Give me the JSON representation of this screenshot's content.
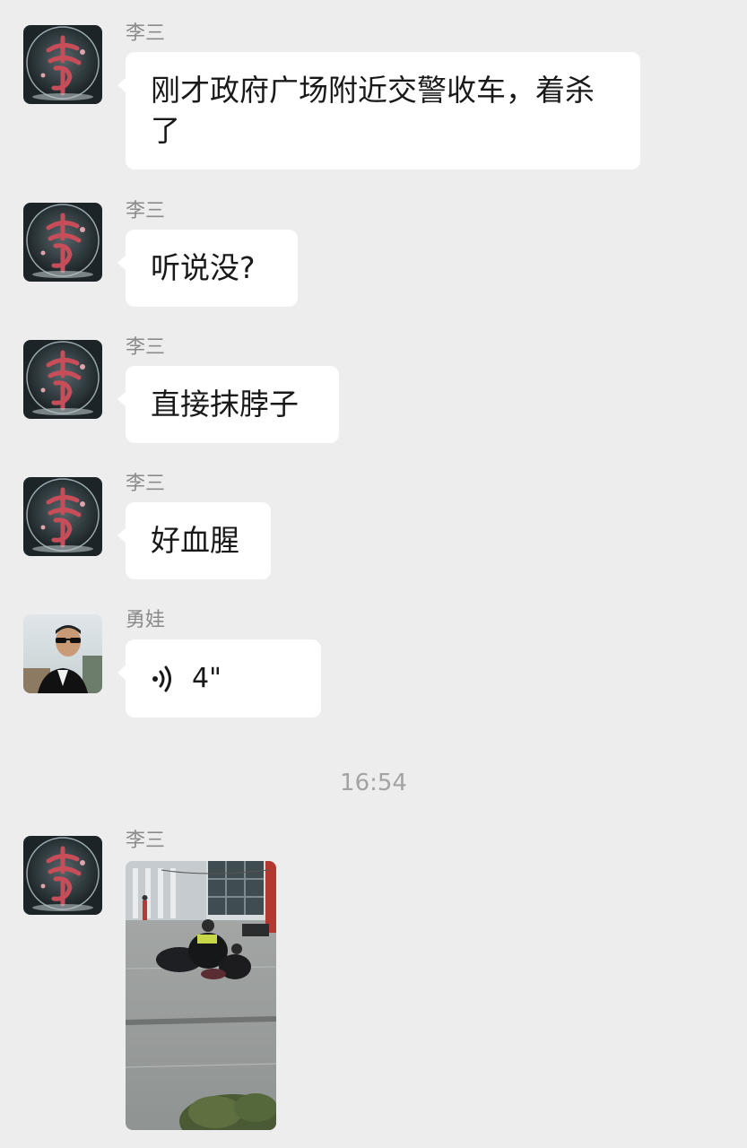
{
  "chat": {
    "messages": [
      {
        "sender": "李三",
        "text": "刚才政府广场附近交警收车，着杀了",
        "avatar_icon": "li-character-avatar-icon"
      },
      {
        "sender": "李三",
        "text": "听说没?",
        "avatar_icon": "li-character-avatar-icon"
      },
      {
        "sender": "李三",
        "text": "直接抹脖子",
        "avatar_icon": "li-character-avatar-icon"
      },
      {
        "sender": "李三",
        "text": "好血腥",
        "avatar_icon": "li-character-avatar-icon"
      },
      {
        "sender": "勇娃",
        "voice_duration": "4\"",
        "avatar_icon": "man-sunglasses-avatar-icon",
        "voice_icon": "voice-wave-icon"
      },
      {
        "sender": "李三",
        "image": "street-scene-photo",
        "avatar_icon": "li-character-avatar-icon"
      }
    ],
    "timestamp": "16:54"
  },
  "colors": {
    "background": "#ededed",
    "bubble": "#ffffff",
    "sender_name": "#8a8a8a",
    "text": "#191919",
    "timestamp": "#a3a3a3"
  }
}
